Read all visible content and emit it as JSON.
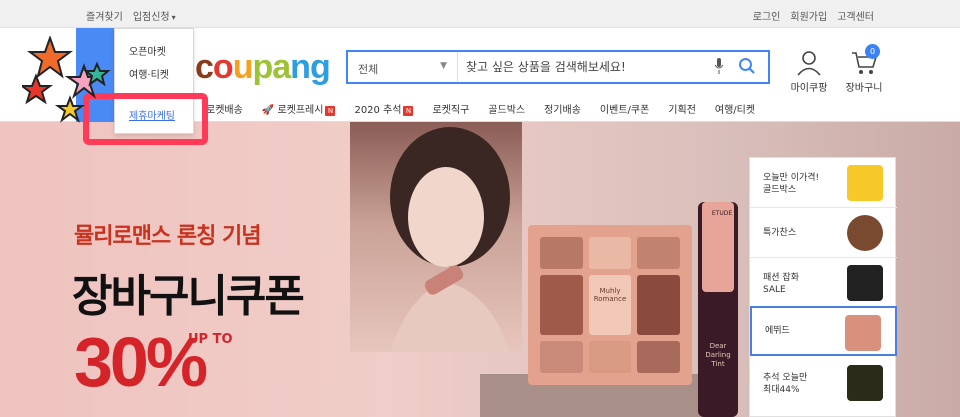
{
  "topbar": {
    "favorites": "즐겨찾기",
    "store_apply": "입점신청",
    "login": "로그인",
    "signup": "회원가입",
    "customer_center": "고객센터"
  },
  "dropdown": {
    "items": [
      "오픈마켓",
      "여행·티켓",
      "제휴마케팅"
    ]
  },
  "logo": {
    "c1": "c",
    "c2": "o",
    "c3": "u",
    "c4": "pa",
    "c5": "ng"
  },
  "search": {
    "category": "전체",
    "placeholder": "찾고 싶은 상품을 검색해보세요!"
  },
  "account": {
    "my": "마이쿠팡",
    "cart": "장바구니",
    "cart_count": "0"
  },
  "nav": {
    "items": [
      "로켓배송",
      "로켓프레시",
      "2020 추석",
      "로켓직구",
      "골드박스",
      "정기배송",
      "이벤트/쿠폰",
      "기획전",
      "여행/티켓"
    ],
    "new_badge": "N"
  },
  "banner": {
    "subtitle": "뮬리로맨스 론칭 기념",
    "title": "장바구니쿠폰",
    "up_to": "UP TO",
    "percent": "30%"
  },
  "product": {
    "palette_label": "Muhly Romance",
    "tint_brand": "ETUDE",
    "tint_name": "Dear Darling Tint"
  },
  "side_list": [
    {
      "line1": "오늘만 이가격!",
      "line2": "골드박스"
    },
    {
      "line1": "특가찬스",
      "line2": ""
    },
    {
      "line1": "패션 잡화",
      "line2": "SALE"
    },
    {
      "line1": "에뛰드",
      "line2": ""
    },
    {
      "line1": "추석 오늘만",
      "line2": "최대44%"
    }
  ],
  "colors": {
    "accent_blue": "#4285f4",
    "highlight_red": "#ff3b59",
    "promo_red": "#d4242a"
  }
}
